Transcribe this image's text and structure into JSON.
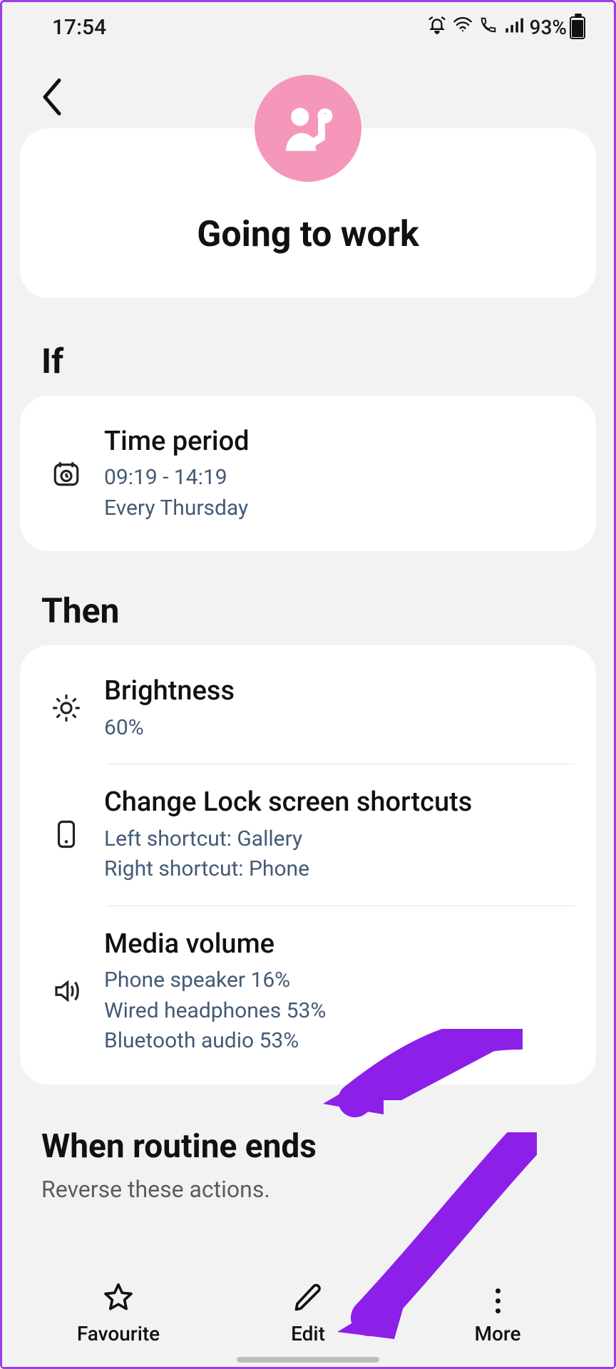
{
  "statusbar": {
    "time": "17:54",
    "battery": "93%"
  },
  "hero": {
    "title": "Going to work"
  },
  "sections": {
    "if_label": "If",
    "then_label": "Then",
    "ends_label": "When routine ends",
    "ends_sub": "Reverse these actions."
  },
  "if_item": {
    "title": "Time period",
    "line1": "09:19 - 14:19",
    "line2": "Every Thursday"
  },
  "then_items": {
    "brightness": {
      "title": "Brightness",
      "sub": "60%"
    },
    "lockshortcut": {
      "title": "Change Lock screen shortcuts",
      "line1": "Left shortcut: Gallery",
      "line2": "Right shortcut: Phone"
    },
    "media": {
      "title": "Media volume",
      "line1": "Phone speaker 16%",
      "line2": "Wired headphones 53%",
      "line3": "Bluetooth audio 53%"
    }
  },
  "bottom": {
    "fav": "Favourite",
    "edit": "Edit",
    "more": "More"
  },
  "colors": {
    "accent_pink": "#f497bb",
    "annotation_purple": "#8c1fe8"
  }
}
